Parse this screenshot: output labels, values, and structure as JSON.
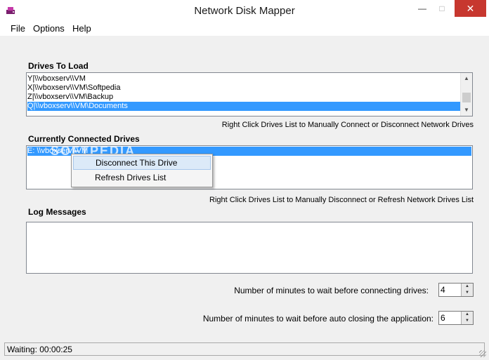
{
  "window": {
    "title": "Network Disk Mapper",
    "icon": "app-icon",
    "controls": {
      "minimize": "—",
      "maximize": "□",
      "close": "✕"
    }
  },
  "menu": {
    "file": "File",
    "options": "Options",
    "help": "Help"
  },
  "drives_to_load": {
    "label": "Drives To Load",
    "items": [
      "Y|\\\\vboxserv\\\\VM",
      "X|\\\\vboxserv\\\\VM\\Softpedia",
      "Z|\\\\vboxserv\\\\VM\\Backup",
      "Q|\\\\vboxserv\\\\VM\\Documents"
    ],
    "selected_index": 3,
    "hint": "Right Click Drives List to Manually Connect or Disconnect Network Drives"
  },
  "connected_drives": {
    "label": "Currently Connected Drives",
    "items": [
      "E: \\\\vboxserv\\\\VM"
    ],
    "selected_index": 0,
    "hint": "Right Click Drives List to Manually Disconnect or Refresh Network Drives List"
  },
  "context_menu": {
    "items": [
      "Disconnect This Drive",
      "Refresh Drives List"
    ],
    "highlighted_index": 0
  },
  "watermark": "SOFTPEDIA",
  "log": {
    "label": "Log Messages",
    "content": ""
  },
  "settings": {
    "connect_wait_label": "Number of minutes to wait before connecting drives:",
    "connect_wait_value": "4",
    "close_wait_label": "Number of minutes to wait before auto closing the application:",
    "close_wait_value": "6"
  },
  "status": {
    "text": "Waiting: 00:00:25"
  },
  "colors": {
    "selection": "#3399ff",
    "close_button": "#c7372f",
    "menu_highlight": "#dceaf8"
  }
}
